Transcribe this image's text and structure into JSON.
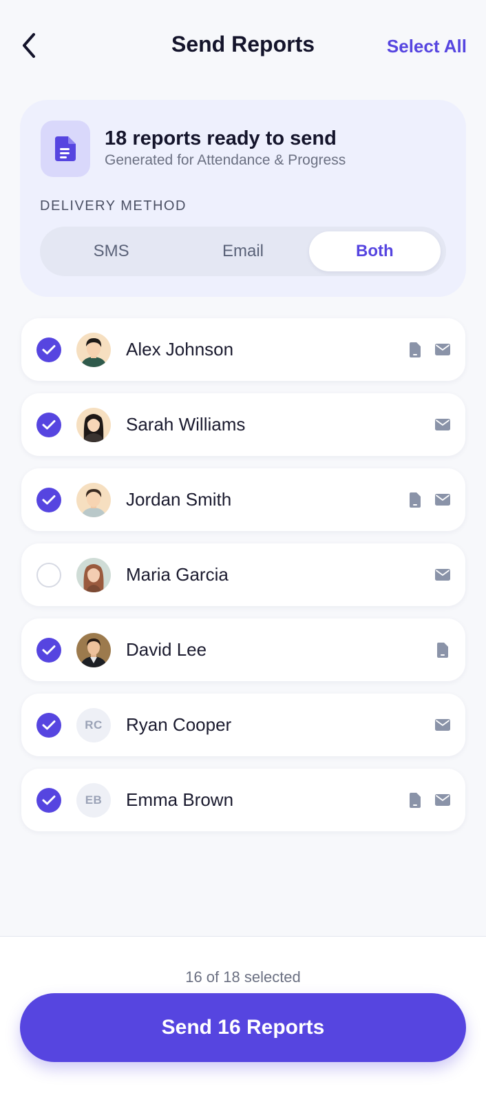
{
  "header": {
    "title": "Send Reports",
    "select_all": "Select All"
  },
  "summary": {
    "title": "18 reports ready to send",
    "subtitle": "Generated for Attendance & Progress",
    "delivery_label": "DELIVERY METHOD",
    "options": [
      "SMS",
      "Email",
      "Both"
    ],
    "selected_option": "Both"
  },
  "students": [
    {
      "name": "Alex Johnson",
      "checked": true,
      "avatar": "photo",
      "sms": true,
      "email": true
    },
    {
      "name": "Sarah Williams",
      "checked": true,
      "avatar": "photo",
      "sms": false,
      "email": true
    },
    {
      "name": "Jordan Smith",
      "checked": true,
      "avatar": "photo",
      "sms": true,
      "email": true
    },
    {
      "name": "Maria Garcia",
      "checked": false,
      "avatar": "photo",
      "sms": false,
      "email": true
    },
    {
      "name": "David Lee",
      "checked": true,
      "avatar": "photo",
      "sms": true,
      "email": false
    },
    {
      "name": "Ryan Cooper",
      "checked": true,
      "avatar": "initials",
      "initials": "RC",
      "sms": false,
      "email": true
    },
    {
      "name": "Emma Brown",
      "checked": true,
      "avatar": "initials",
      "initials": "EB",
      "sms": true,
      "email": true
    }
  ],
  "footer": {
    "count_text": "16 of 18 selected",
    "send_label": "Send 16 Reports"
  },
  "colors": {
    "accent": "#5645e0",
    "background": "#f7f8fb",
    "card": "#eef0fd"
  }
}
